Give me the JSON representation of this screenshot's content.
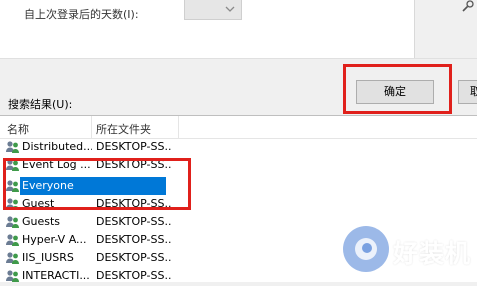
{
  "query": {
    "days_label": "自上次登录后的天数(I):",
    "days_value": ""
  },
  "buttons": {
    "ok_label": "确定",
    "cancel_label": "取"
  },
  "results": {
    "label": "搜索结果(U):",
    "columns": [
      "名称",
      "所在文件夹"
    ],
    "rows": [
      {
        "name": "Distributed...",
        "folder": "DESKTOP-SS..."
      },
      {
        "name": "Event Log ...",
        "folder": "DESKTOP-SS..."
      },
      {
        "name": "Everyone",
        "folder": "",
        "selected": true
      },
      {
        "name": "Guest",
        "folder": "DESKTOP-SS..."
      },
      {
        "name": "Guests",
        "folder": "DESKTOP-SS..."
      },
      {
        "name": "Hyper-V A...",
        "folder": "DESKTOP-SS..."
      },
      {
        "name": "IIS_IUSRS",
        "folder": "DESKTOP-SS..."
      },
      {
        "name": "INTERACTI...",
        "folder": "DESKTOP-SS..."
      }
    ]
  },
  "watermark": {
    "text": "好装机"
  },
  "colors": {
    "highlight": "#e0201b",
    "selection": "#0078d7"
  }
}
